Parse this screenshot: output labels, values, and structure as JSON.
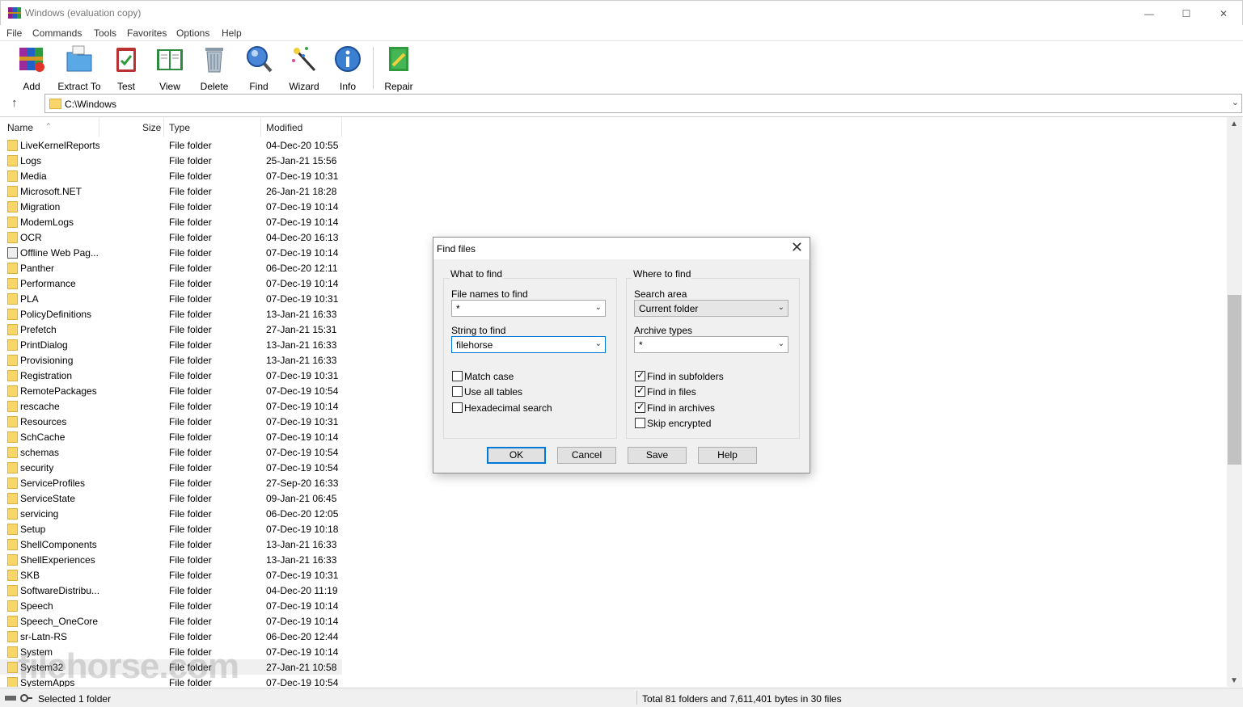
{
  "window": {
    "title": "Windows (evaluation copy)",
    "minimize": "—",
    "maximize": "☐",
    "close": "✕"
  },
  "menu": [
    "File",
    "Commands",
    "Tools",
    "Favorites",
    "Options",
    "Help"
  ],
  "toolbar": [
    {
      "label": "Add",
      "icon": "add-archive-icon"
    },
    {
      "label": "Extract To",
      "icon": "extract-folder-icon"
    },
    {
      "label": "Test",
      "icon": "test-clipboard-icon"
    },
    {
      "label": "View",
      "icon": "view-book-icon"
    },
    {
      "label": "Delete",
      "icon": "trash-icon"
    },
    {
      "label": "Find",
      "icon": "magnifier-icon"
    },
    {
      "label": "Wizard",
      "icon": "magic-wand-icon"
    },
    {
      "label": "Info",
      "icon": "info-icon"
    },
    {
      "label": "Repair",
      "icon": "repair-kit-icon"
    }
  ],
  "address": {
    "up_icon": "↑",
    "path": "C:\\Windows",
    "chevron": "⌄"
  },
  "columns": {
    "name": "Name",
    "size": "Size",
    "type": "Type",
    "modified": "Modified",
    "sort_caret": "^"
  },
  "files": [
    {
      "name": "LiveKernelReports",
      "type": "File folder",
      "modified": "04-Dec-20 10:55"
    },
    {
      "name": "Logs",
      "type": "File folder",
      "modified": "25-Jan-21 15:56"
    },
    {
      "name": "Media",
      "type": "File folder",
      "modified": "07-Dec-19 10:31"
    },
    {
      "name": "Microsoft.NET",
      "type": "File folder",
      "modified": "26-Jan-21 18:28"
    },
    {
      "name": "Migration",
      "type": "File folder",
      "modified": "07-Dec-19 10:14"
    },
    {
      "name": "ModemLogs",
      "type": "File folder",
      "modified": "07-Dec-19 10:14"
    },
    {
      "name": "OCR",
      "type": "File folder",
      "modified": "04-Dec-20 16:13"
    },
    {
      "name": "Offline Web Pag...",
      "type": "File folder",
      "modified": "07-Dec-19 10:14",
      "special": true
    },
    {
      "name": "Panther",
      "type": "File folder",
      "modified": "06-Dec-20 12:11"
    },
    {
      "name": "Performance",
      "type": "File folder",
      "modified": "07-Dec-19 10:14"
    },
    {
      "name": "PLA",
      "type": "File folder",
      "modified": "07-Dec-19 10:31"
    },
    {
      "name": "PolicyDefinitions",
      "type": "File folder",
      "modified": "13-Jan-21 16:33"
    },
    {
      "name": "Prefetch",
      "type": "File folder",
      "modified": "27-Jan-21 15:31"
    },
    {
      "name": "PrintDialog",
      "type": "File folder",
      "modified": "13-Jan-21 16:33"
    },
    {
      "name": "Provisioning",
      "type": "File folder",
      "modified": "13-Jan-21 16:33"
    },
    {
      "name": "Registration",
      "type": "File folder",
      "modified": "07-Dec-19 10:31"
    },
    {
      "name": "RemotePackages",
      "type": "File folder",
      "modified": "07-Dec-19 10:54"
    },
    {
      "name": "rescache",
      "type": "File folder",
      "modified": "07-Dec-19 10:14"
    },
    {
      "name": "Resources",
      "type": "File folder",
      "modified": "07-Dec-19 10:31"
    },
    {
      "name": "SchCache",
      "type": "File folder",
      "modified": "07-Dec-19 10:14"
    },
    {
      "name": "schemas",
      "type": "File folder",
      "modified": "07-Dec-19 10:54"
    },
    {
      "name": "security",
      "type": "File folder",
      "modified": "07-Dec-19 10:54"
    },
    {
      "name": "ServiceProfiles",
      "type": "File folder",
      "modified": "27-Sep-20 16:33"
    },
    {
      "name": "ServiceState",
      "type": "File folder",
      "modified": "09-Jan-21 06:45"
    },
    {
      "name": "servicing",
      "type": "File folder",
      "modified": "06-Dec-20 12:05"
    },
    {
      "name": "Setup",
      "type": "File folder",
      "modified": "07-Dec-19 10:18"
    },
    {
      "name": "ShellComponents",
      "type": "File folder",
      "modified": "13-Jan-21 16:33"
    },
    {
      "name": "ShellExperiences",
      "type": "File folder",
      "modified": "13-Jan-21 16:33"
    },
    {
      "name": "SKB",
      "type": "File folder",
      "modified": "07-Dec-19 10:31"
    },
    {
      "name": "SoftwareDistribu...",
      "type": "File folder",
      "modified": "04-Dec-20 11:19"
    },
    {
      "name": "Speech",
      "type": "File folder",
      "modified": "07-Dec-19 10:14"
    },
    {
      "name": "Speech_OneCore",
      "type": "File folder",
      "modified": "07-Dec-19 10:14"
    },
    {
      "name": "sr-Latn-RS",
      "type": "File folder",
      "modified": "06-Dec-20 12:44"
    },
    {
      "name": "System",
      "type": "File folder",
      "modified": "07-Dec-19 10:14"
    },
    {
      "name": "System32",
      "type": "File folder",
      "modified": "27-Jan-21 10:58",
      "selected": true
    },
    {
      "name": "SystemApps",
      "type": "File folder",
      "modified": "07-Dec-19 10:54"
    }
  ],
  "status": {
    "left": "Selected 1 folder",
    "right": "Total 81 folders and 7,611,401 bytes in 30 files"
  },
  "watermark": "filehorse.com",
  "dialog": {
    "title": "Find files",
    "close": "✕",
    "what_group": "What to find",
    "file_names_label": "File names to find",
    "file_names_value": "*",
    "string_label": "String to find",
    "string_value": "filehorse",
    "match_case": "Match case",
    "use_all_tables": "Use all tables",
    "hex_search": "Hexadecimal search",
    "where_group": "Where to find",
    "search_area_label": "Search area",
    "search_area_value": "Current folder",
    "archive_types_label": "Archive types",
    "archive_types_value": "*",
    "find_subfolders": "Find in subfolders",
    "find_files": "Find in files",
    "find_archives": "Find in archives",
    "skip_encrypted": "Skip encrypted",
    "ok": "OK",
    "cancel": "Cancel",
    "save": "Save",
    "help": "Help",
    "checks": {
      "match_case": false,
      "use_all_tables": false,
      "hex_search": false,
      "find_subfolders": true,
      "find_files": true,
      "find_archives": true,
      "skip_encrypted": false
    }
  }
}
